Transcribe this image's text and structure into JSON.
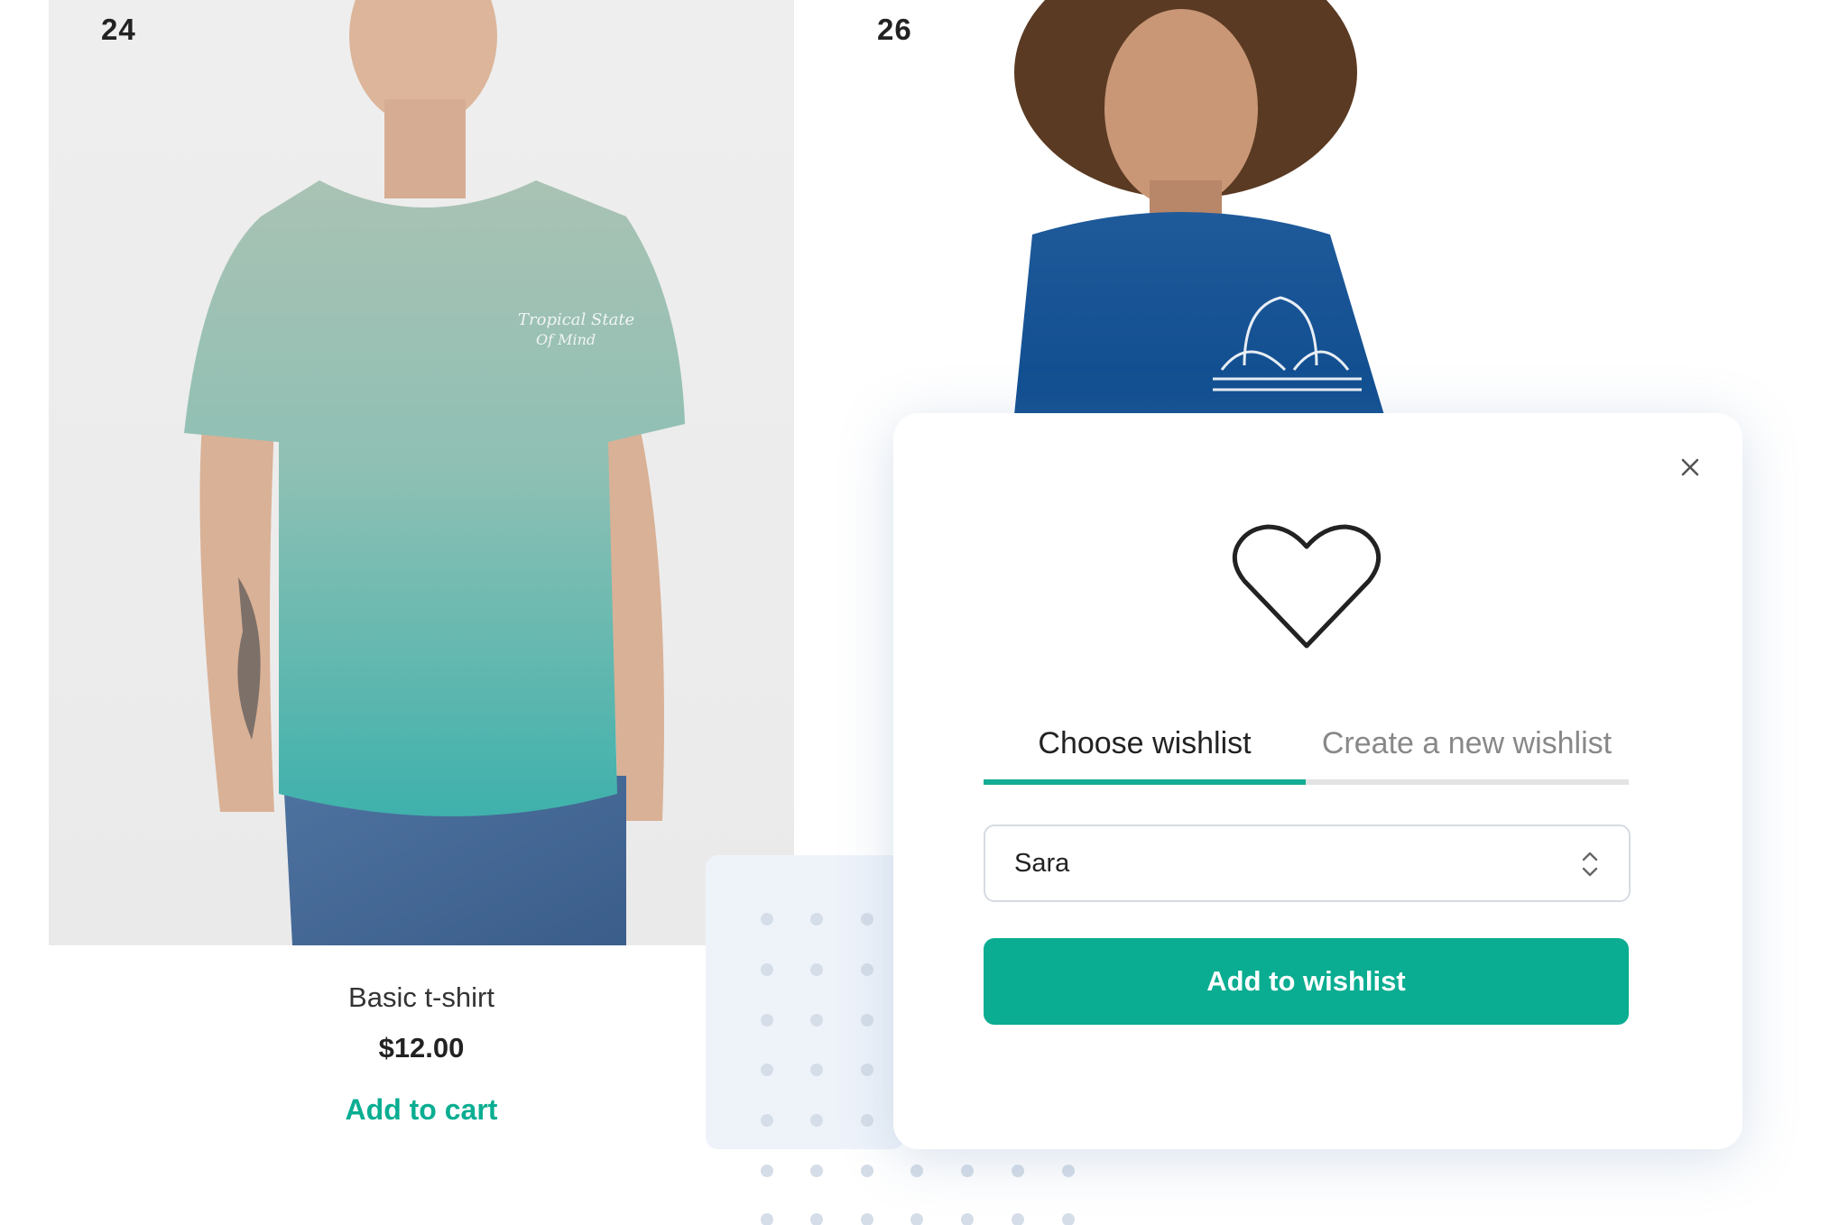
{
  "products": [
    {
      "number": "24",
      "name": "Basic t-shirt",
      "price": "$12.00",
      "cta": "Add to cart",
      "image_icon": "person-in-teal-tshirt-photo"
    },
    {
      "number": "26",
      "image_icon": "person-in-blue-adidas-tshirt-photo"
    }
  ],
  "modal": {
    "icon": "heart-icon",
    "close_icon": "close-icon",
    "tabs": [
      {
        "label": "Choose wishlist",
        "active": true
      },
      {
        "label": "Create a new wishlist",
        "active": false
      }
    ],
    "select": {
      "value": "Sara",
      "icon": "select-arrows-icon"
    },
    "submit_label": "Add to wishlist"
  },
  "colors": {
    "accent": "#0aad91",
    "tab_inactive": "#888888",
    "tab_track": "#e3e3e3"
  }
}
